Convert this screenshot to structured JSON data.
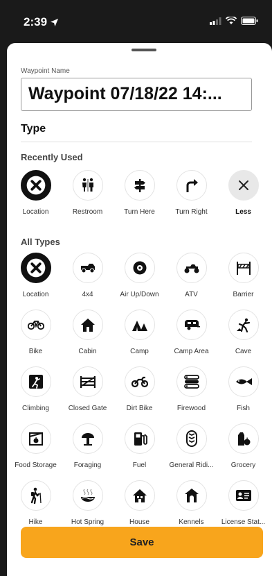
{
  "status": {
    "time": "2:39"
  },
  "waypoint": {
    "label": "Waypoint Name",
    "value": "Waypoint 07/18/22 14:..."
  },
  "type_heading": "Type",
  "recently_used": {
    "title": "Recently Used",
    "items": [
      {
        "label": "Location",
        "icon": "x-icon",
        "selected": true
      },
      {
        "label": "Restroom",
        "icon": "restroom-icon"
      },
      {
        "label": "Turn Here",
        "icon": "signpost-icon"
      },
      {
        "label": "Turn Right",
        "icon": "turn-right-icon"
      },
      {
        "label": "Less",
        "icon": "close-icon"
      }
    ]
  },
  "all_types": {
    "title": "All Types",
    "items": [
      {
        "label": "Location",
        "icon": "x-icon",
        "selected": true
      },
      {
        "label": "4x4",
        "icon": "truck-icon"
      },
      {
        "label": "Air Up/Down",
        "icon": "tire-icon"
      },
      {
        "label": "ATV",
        "icon": "atv-icon"
      },
      {
        "label": "Barrier",
        "icon": "barrier-icon"
      },
      {
        "label": "Bike",
        "icon": "bike-icon"
      },
      {
        "label": "Cabin",
        "icon": "cabin-icon"
      },
      {
        "label": "Camp",
        "icon": "tent-icon"
      },
      {
        "label": "Camp Area",
        "icon": "camper-icon"
      },
      {
        "label": "Cave",
        "icon": "cave-icon"
      },
      {
        "label": "Climbing",
        "icon": "climbing-icon"
      },
      {
        "label": "Closed Gate",
        "icon": "gate-icon"
      },
      {
        "label": "Dirt Bike",
        "icon": "dirt-bike-icon"
      },
      {
        "label": "Firewood",
        "icon": "firewood-icon"
      },
      {
        "label": "Fish",
        "icon": "fish-icon"
      },
      {
        "label": "Food Storage",
        "icon": "food-storage-icon"
      },
      {
        "label": "Foraging",
        "icon": "mushroom-icon"
      },
      {
        "label": "Fuel",
        "icon": "fuel-pump-icon"
      },
      {
        "label": "General Ridi...",
        "icon": "tread-icon"
      },
      {
        "label": "Grocery",
        "icon": "grocery-icon"
      },
      {
        "label": "Hike",
        "icon": "hiker-icon"
      },
      {
        "label": "Hot Spring",
        "icon": "hot-spring-icon"
      },
      {
        "label": "House",
        "icon": "house-icon"
      },
      {
        "label": "Kennels",
        "icon": "kennel-icon"
      },
      {
        "label": "License Stat...",
        "icon": "license-icon"
      }
    ]
  },
  "save_label": "Save",
  "colors": {
    "accent": "#f8a51c",
    "selected": "#111111"
  }
}
